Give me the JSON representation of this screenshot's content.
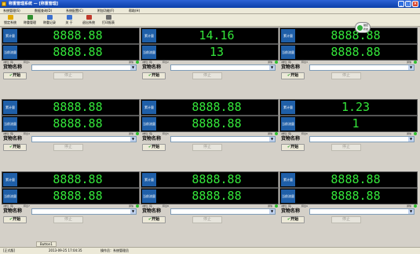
{
  "window": {
    "title": "称重管理系统 — [称重管理]",
    "controls": [
      "_",
      "□",
      "×"
    ]
  },
  "menu": [
    "系统管理(S)",
    "数据查询(D)",
    "系统配置(C)",
    "附加功能(F)",
    "帮助(H)"
  ],
  "toolbar": [
    {
      "label": "锁定系统",
      "color": "#e0a800"
    },
    {
      "label": "称重管理",
      "color": "#2f8f2f"
    },
    {
      "label": "称重记录",
      "color": "#3a6fcf"
    },
    {
      "label": "关 于",
      "color": "#3a6fcf"
    },
    {
      "label": "退出系统",
      "color": "#c0392b"
    },
    {
      "label": "打印报表",
      "color": "#6b6b6b"
    }
  ],
  "labels": {
    "cumulative": "累计量",
    "current_flow": "当前流量",
    "goods_name": "货物名称",
    "start": "开始",
    "stop": "停止",
    "comm": "通信"
  },
  "panels": [
    {
      "cumulative": "8888.88",
      "flow": "8888.88",
      "unit": "(单位: 吨)",
      "scale": "秤台1"
    },
    {
      "cumulative": "14.16",
      "flow": "13",
      "unit": "(单位: 吨)",
      "scale": "秤台2"
    },
    {
      "cumulative": "8888.88",
      "flow": "8888.88",
      "unit": "(单位: 吨)",
      "scale": "秤台3"
    },
    {
      "cumulative": "8888.88",
      "flow": "8888.88",
      "unit": "(单位: 吨)",
      "scale": "秤台4"
    },
    {
      "cumulative": "8888.88",
      "flow": "8888.88",
      "unit": "(单位: 吨)",
      "scale": "秤台5"
    },
    {
      "cumulative": "1.23",
      "flow": "1",
      "unit": "(单位: 吨)",
      "scale": "秤台6"
    },
    {
      "cumulative": "8888.88",
      "flow": "8888.88",
      "unit": "(单位: 吨)",
      "scale": "秤台7"
    },
    {
      "cumulative": "8888.88",
      "flow": "8888.88",
      "unit": "(单位: 吨)",
      "scale": "秤台8"
    },
    {
      "cumulative": "8888.88",
      "flow": "8888.88",
      "unit": "(单位: 吨)",
      "scale": "秤台9"
    }
  ],
  "badge": {
    "line1": "锁定",
    "line2": "状态"
  },
  "bottom_tab": "Button1",
  "status": {
    "mode": "[正式版]",
    "datetime": "2013-09-25 17:04:35",
    "operator": "操作员：系统管理员"
  }
}
